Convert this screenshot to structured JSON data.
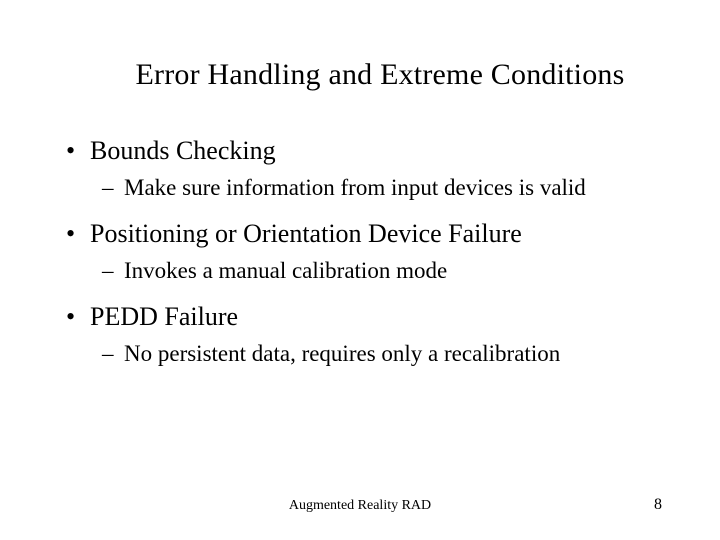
{
  "title": "Error Handling and Extreme Conditions",
  "bullets": {
    "b1_0": "Bounds Checking",
    "b1_0_sub": "Make sure information from input devices is valid",
    "b1_1": "Positioning or Orientation Device Failure",
    "b1_1_sub": "Invokes a manual calibration mode",
    "b1_2": "PEDD Failure",
    "b1_2_sub": "No persistent data, requires only a recalibration"
  },
  "footer": "Augmented Reality RAD",
  "page_number": "8"
}
